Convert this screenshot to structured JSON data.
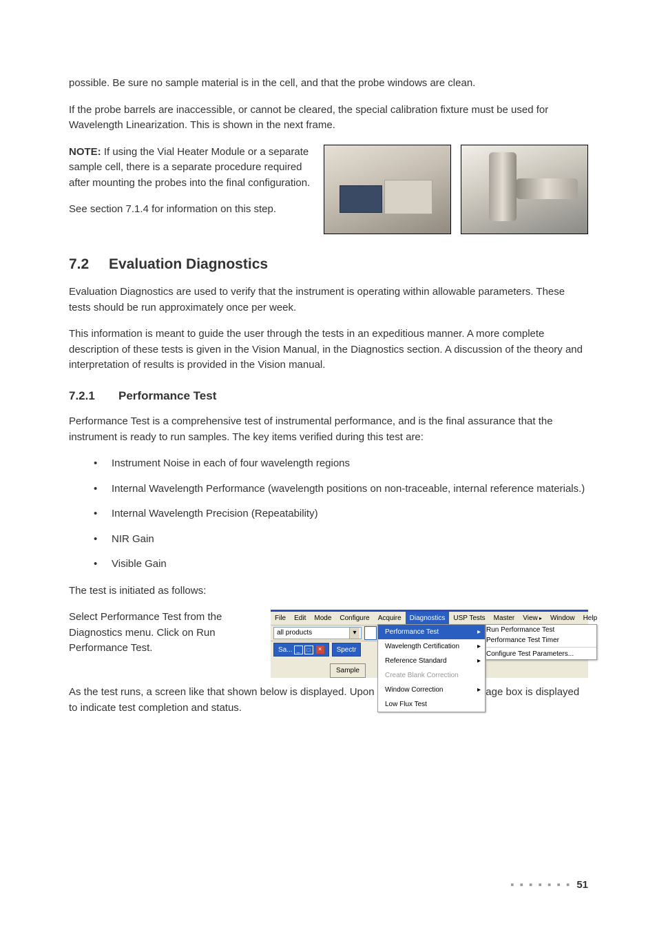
{
  "intro": {
    "p1": "possible. Be sure no sample material is in the cell, and that the probe windows are clean.",
    "p2": "If the probe barrels are inaccessible, or cannot be cleared, the special calibration fixture must be used for Wavelength Linearization. This is shown in the next frame.",
    "note_label": "NOTE:",
    "note_body": " If using the Vial Heater Module or a separate sample cell, there is a separate procedure required after mounting the probes into the final configuration.",
    "see": "See section 7.1.4 for information on this step."
  },
  "sec72": {
    "num": "7.2",
    "title": "Evaluation Diagnostics",
    "p1": "Evaluation Diagnostics are used to verify that the instrument is operating within allowable parameters. These tests should be run approximately once per week.",
    "p2": "This information is meant to guide the user through the tests in an expeditious manner. A more complete description of these tests is given in the Vision Manual, in the Diagnostics section. A discussion of the theory and interpretation of results is provided in the Vision manual."
  },
  "sec721": {
    "num": "7.2.1",
    "title": "Performance Test",
    "p1": "Performance Test is a comprehensive test of instrumental performance, and is the final assurance that the instrument is ready to run samples. The key items verified during this test are:",
    "bullets": [
      "Instrument Noise in each of four wavelength regions",
      "Internal Wavelength Performance (wavelength positions on non-traceable, internal reference materials.)",
      "Internal Wavelength Precision (Repeatability)",
      "NIR Gain",
      "Visible Gain"
    ],
    "p2": "The test is initiated as follows:",
    "step": "Select Performance Test from the Diagnostics menu. Click on Run Performance Test.",
    "p3": "As the test runs, a screen like that shown below is displayed. Upon test completion, a message box is displayed to indicate test completion and status."
  },
  "screenshot": {
    "menubar": [
      "File",
      "Edit",
      "Mode",
      "Configure",
      "Acquire",
      "Diagnostics",
      "USP Tests",
      "Master",
      "View",
      "Window",
      "Help"
    ],
    "selected_menu_index": 5,
    "view_arrow_index": 8,
    "combo_value": "all products",
    "win_sa": "Sa...",
    "win_spectr": "Spectr",
    "sample_btn": "Sample",
    "dropdown": [
      {
        "label": "Performance Test",
        "sel": true,
        "arr": true
      },
      {
        "label": "Wavelength Certification",
        "arr": true
      },
      {
        "label": "Reference Standard",
        "arr": true
      },
      {
        "label": "Create Blank Correction",
        "dis": true
      },
      {
        "label": "Window Correction",
        "arr": true
      },
      {
        "label": "Low Flux Test"
      }
    ],
    "submenu": [
      {
        "label": "Run Performance Test",
        "sel": true
      },
      {
        "label": "Performance Test Timer"
      },
      {
        "label": "Configure Test Parameters..."
      }
    ]
  },
  "page_number": "51",
  "page_dots": "▪ ▪ ▪ ▪ ▪ ▪ ▪"
}
